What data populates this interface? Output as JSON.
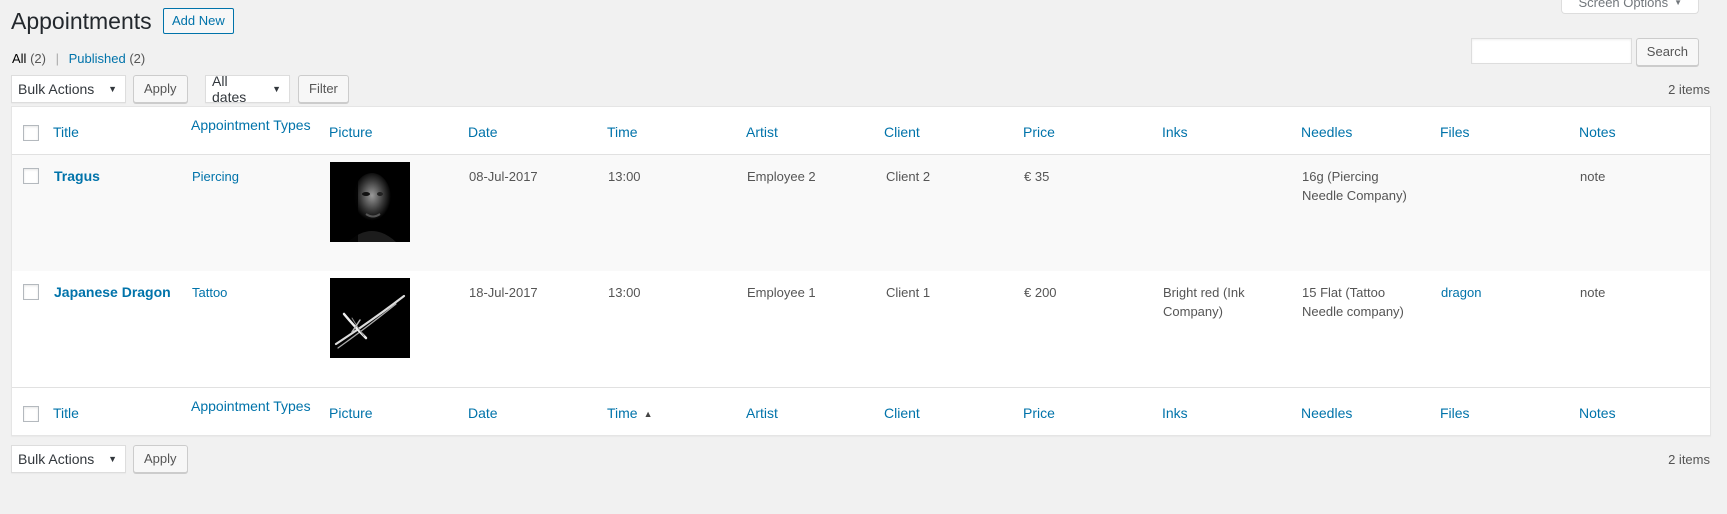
{
  "screen_options": {
    "label": "Screen Options"
  },
  "page": {
    "title": "Appointments",
    "add_new": "Add New"
  },
  "views": {
    "all_label": "All",
    "all_count": "(2)",
    "separator": "|",
    "published_label": "Published",
    "published_count": "(2)"
  },
  "search": {
    "button": "Search"
  },
  "toolbar": {
    "bulk_actions": "Bulk Actions",
    "apply": "Apply",
    "all_dates": "All dates",
    "filter": "Filter",
    "items_count": "2 items"
  },
  "columns": [
    "Title",
    "Appointment Types",
    "Picture",
    "Date",
    "Time",
    "Artist",
    "Client",
    "Price",
    "Inks",
    "Needles",
    "Files",
    "Notes"
  ],
  "rows": [
    {
      "title": "Tragus",
      "type": "Piercing",
      "picture": "portrait",
      "date": "08-Jul-2017",
      "time": "13:00",
      "artist": "Employee 2",
      "client": "Client 2",
      "price": "€ 35",
      "inks": "",
      "needles": "16g (Piercing Needle Company)",
      "files": "",
      "notes": "note"
    },
    {
      "title": "Japanese Dragon",
      "type": "Tattoo",
      "picture": "strokes",
      "date": "18-Jul-2017",
      "time": "13:00",
      "artist": "Employee 1",
      "client": "Client 1",
      "price": "€ 200",
      "inks": "Bright red (Ink Company)",
      "needles": "15 Flat (Tattoo Needle company)",
      "files": "dragon",
      "notes": "note"
    }
  ],
  "colors": {
    "link": "#0073aa",
    "background": "#f1f1f1",
    "alt_row": "#f9f9f9"
  }
}
